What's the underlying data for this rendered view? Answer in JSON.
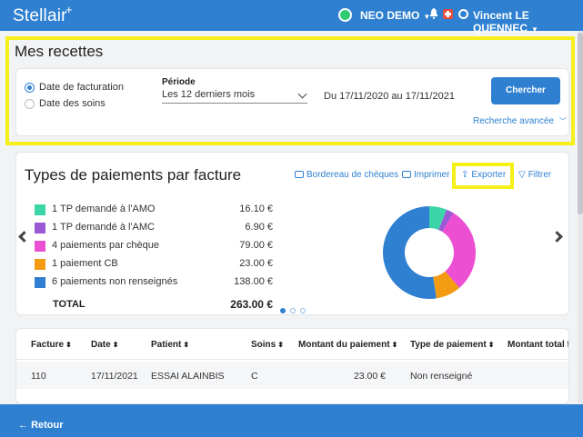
{
  "header": {
    "logo": "Stellair",
    "org_name": "NEO DEMO",
    "user_name": "Vincent LE QUENNEC"
  },
  "page": {
    "title": "Mes recettes"
  },
  "search": {
    "radio_billing": "Date de facturation",
    "radio_care": "Date des soins",
    "periode_label": "Période",
    "periode_value": "Les 12 derniers mois",
    "date_range": "Du 17/11/2020 au 17/11/2021",
    "search_button": "Chercher",
    "advanced_link": "Recherche avancée"
  },
  "payments": {
    "title": "Types de paiements par facture",
    "actions": {
      "bordereau": "Bordereau de chèques",
      "print": "Imprimer",
      "export": "Exporter",
      "filter": "Filtrer"
    },
    "legend": [
      {
        "label": "1 TP demandé à l'AMO",
        "amount": "16.10 €",
        "color": "#3ad6a8"
      },
      {
        "label": "1 TP demandé à l'AMC",
        "amount": "6.90 €",
        "color": "#9b59d6"
      },
      {
        "label": "4 paiements par chèque",
        "amount": "79.00 €",
        "color": "#ec4fd1"
      },
      {
        "label": "1 paiement CB",
        "amount": "23.00 €",
        "color": "#f39c12"
      },
      {
        "label": "6 paiements non renseignés",
        "amount": "138.00 €",
        "color": "#2f80d1"
      }
    ],
    "total_label": "TOTAL",
    "total_amount": "263.00 €"
  },
  "chart_data": {
    "type": "pie",
    "categories": [
      "1 TP demandé à l'AMO",
      "1 TP demandé à l'AMC",
      "4 paiements par chèque",
      "1 paiement CB",
      "6 paiements non renseignés"
    ],
    "values": [
      16.1,
      6.9,
      79.0,
      23.0,
      138.0
    ],
    "colors": [
      "#3ad6a8",
      "#9b59d6",
      "#ec4fd1",
      "#f39c12",
      "#2f80d1"
    ],
    "title": ""
  },
  "table": {
    "columns": [
      "Facture",
      "Date",
      "Patient",
      "Soins",
      "Montant du paiement",
      "Type de paiement",
      "Montant total fa"
    ],
    "rows": [
      [
        "110",
        "17/11/2021",
        "ESSAI ALAINBIS",
        "C",
        "23.00 €",
        "Non renseigné",
        ""
      ]
    ]
  },
  "footer": {
    "back": "Retour"
  }
}
